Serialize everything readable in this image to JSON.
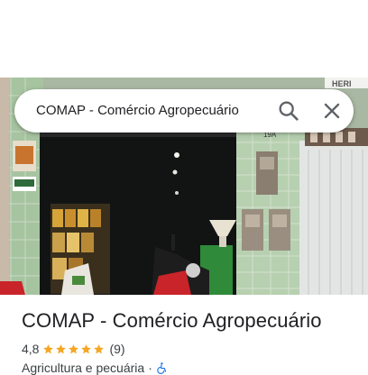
{
  "search": {
    "query": "COMAP - Comércio Agropecuário",
    "search_icon": "search-icon",
    "close_icon": "close-icon"
  },
  "photo": {
    "subject": "storefront-photo",
    "sign_text": "HERI",
    "wall_number": "19A"
  },
  "place": {
    "title": "COMAP - Comércio Agropecuário",
    "rating": "4,8",
    "stars": 5,
    "review_count": "(9)",
    "category": "Agricultura e pecuária",
    "separator": "·",
    "accessibility_icon": "wheelchair-icon"
  },
  "colors": {
    "star": "#f5a623",
    "accessibility": "#1a73e8",
    "text_primary": "#202124",
    "text_secondary": "#3c4043"
  }
}
